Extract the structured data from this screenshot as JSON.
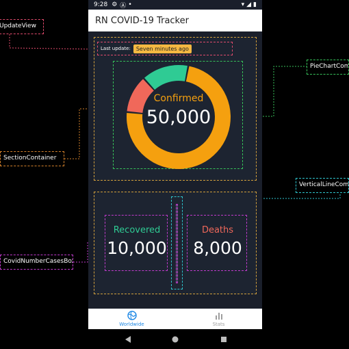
{
  "annotations": {
    "update_view": "UpdateView",
    "pie_chart": "PieChartCompo",
    "section_container": "SectionContainer",
    "vertical_line": "VerticalLineCompo",
    "covid_number_cases_box": "CovidNumberCasesBox"
  },
  "status_bar": {
    "time": "9:28",
    "icons": [
      "gear-icon",
      "android-icon",
      "dot-icon",
      "wifi-icon",
      "signal-icon",
      "battery-icon"
    ]
  },
  "app": {
    "title": "RN COVID-19 Tracker"
  },
  "update": {
    "label": "Last update:",
    "value": "Seven minutes ago"
  },
  "confirmed": {
    "label": "Confirmed",
    "value": "50,000"
  },
  "recovered": {
    "label": "Recovered",
    "value": "10,000"
  },
  "deaths": {
    "label": "Deaths",
    "value": "8,000"
  },
  "donut": {
    "segments": [
      {
        "name": "Confirmed",
        "value": 50000,
        "color": "#f5a00f"
      },
      {
        "name": "Deaths",
        "value": 8000,
        "color": "#f0685a"
      },
      {
        "name": "Recovered",
        "value": 10000,
        "color": "#2fcb94"
      }
    ]
  },
  "colors": {
    "confirmed": "#f5a00f",
    "recovered": "#2fcb94",
    "deaths": "#f0685a",
    "nav_active": "#1e88e5",
    "nav_inactive": "#9e9e9e"
  },
  "nav": {
    "tabs": [
      {
        "label": "Worldwide",
        "icon": "globe-icon",
        "active": true
      },
      {
        "label": "Stats",
        "icon": "bar-chart-icon",
        "active": false
      }
    ]
  },
  "system_nav": {
    "buttons": [
      "back-icon",
      "home-icon",
      "recents-icon"
    ]
  }
}
